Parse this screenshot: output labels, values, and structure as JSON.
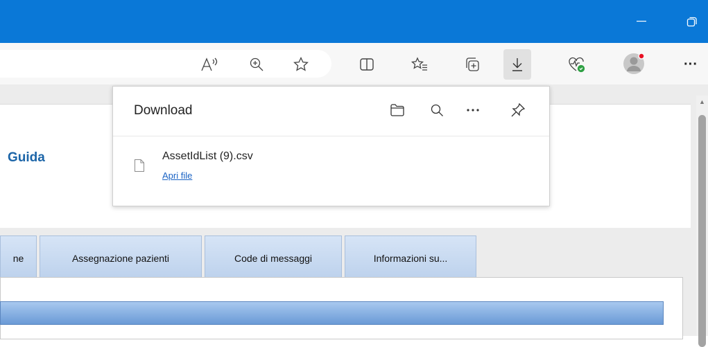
{
  "browser": {
    "accent_color": "#0a78d7",
    "titlebar_buttons": [
      {
        "name": "minimize",
        "icon": "minimize-icon"
      },
      {
        "name": "restore",
        "icon": "restore-icon"
      }
    ],
    "toolbar_icons": [
      "read-aloud-icon",
      "zoom-in-icon",
      "favorite-star-icon",
      "split-screen-icon",
      "favorites-list-icon",
      "collections-icon",
      "downloads-icon",
      "browser-essentials-icon",
      "profile-avatar-icon",
      "more-options-icon"
    ],
    "more_label": "···"
  },
  "downloads_flyout": {
    "title": "Download",
    "header_icons": [
      "open-folder-icon",
      "search-icon",
      "more-icon",
      "pin-icon"
    ],
    "items": [
      {
        "file_name": "AssetIdList (9).csv",
        "action": "Apri file",
        "icon": "file-icon"
      }
    ]
  },
  "page": {
    "guida_link": "Guida",
    "tabs": [
      {
        "label": "ne"
      },
      {
        "label": "Assegnazione pazienti"
      },
      {
        "label": "Code di messaggi"
      },
      {
        "label": "Informazioni su..."
      }
    ]
  }
}
